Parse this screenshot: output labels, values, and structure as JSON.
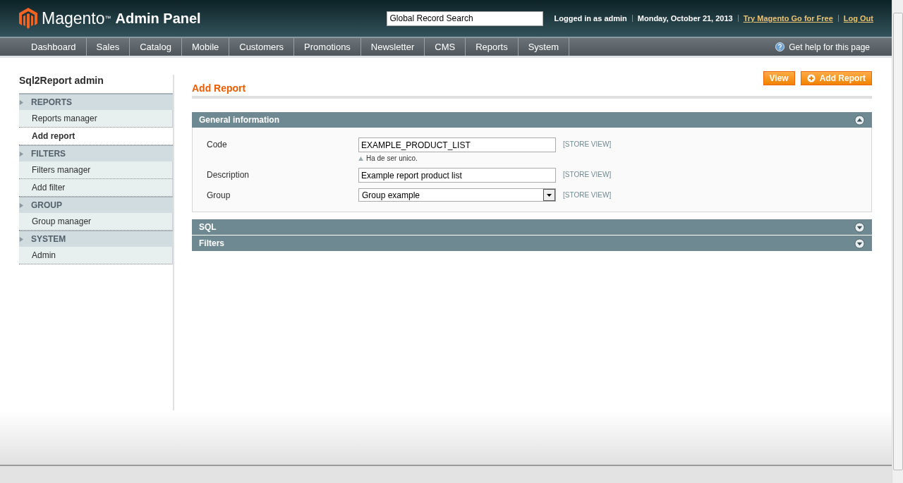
{
  "header": {
    "logo_brand": "Magento",
    "logo_tm": "™",
    "logo_product": "Admin Panel",
    "search": {
      "placeholder": "Global Record Search"
    },
    "user": "Logged in as admin",
    "date": "Monday, October 21, 2013",
    "links": [
      "Try Magento Go for Free",
      "Log Out"
    ]
  },
  "nav": {
    "items": [
      "Dashboard",
      "Sales",
      "Catalog",
      "Mobile",
      "Customers",
      "Promotions",
      "Newsletter",
      "CMS",
      "Reports",
      "System"
    ],
    "help": "Get help for this page"
  },
  "sidebar": {
    "title": "Sql2Report admin",
    "sections": [
      {
        "label": "REPORTS",
        "items": [
          {
            "label": "Reports manager",
            "selected": false
          },
          {
            "label": "Add report",
            "selected": true
          }
        ]
      },
      {
        "label": "FILTERS",
        "items": [
          {
            "label": "Filters manager",
            "selected": false
          },
          {
            "label": "Add filter",
            "selected": false
          }
        ]
      },
      {
        "label": "GROUP",
        "items": [
          {
            "label": "Group manager",
            "selected": false
          }
        ]
      },
      {
        "label": "SYSTEM",
        "items": [
          {
            "label": "Admin",
            "selected": false
          }
        ]
      }
    ]
  },
  "page": {
    "title": "Add Report",
    "buttons": [
      {
        "label": "View",
        "kind": "plain"
      },
      {
        "label": "Add Report",
        "kind": "add"
      }
    ]
  },
  "fieldsets": [
    {
      "title": "General information",
      "expanded": true,
      "fields": [
        {
          "label": "Code",
          "kind": "text",
          "value": "EXAMPLE_PRODUCT_LIST",
          "note": "Ha de ser unico.",
          "scope": "[STORE VIEW]"
        },
        {
          "label": "Description",
          "kind": "text",
          "value": "Example report product list",
          "scope": "[STORE VIEW]"
        },
        {
          "label": "Group",
          "kind": "select",
          "value": "Group example",
          "scope": "[STORE VIEW]"
        }
      ]
    },
    {
      "title": "SQL",
      "expanded": false
    },
    {
      "title": "Filters",
      "expanded": false
    }
  ]
}
